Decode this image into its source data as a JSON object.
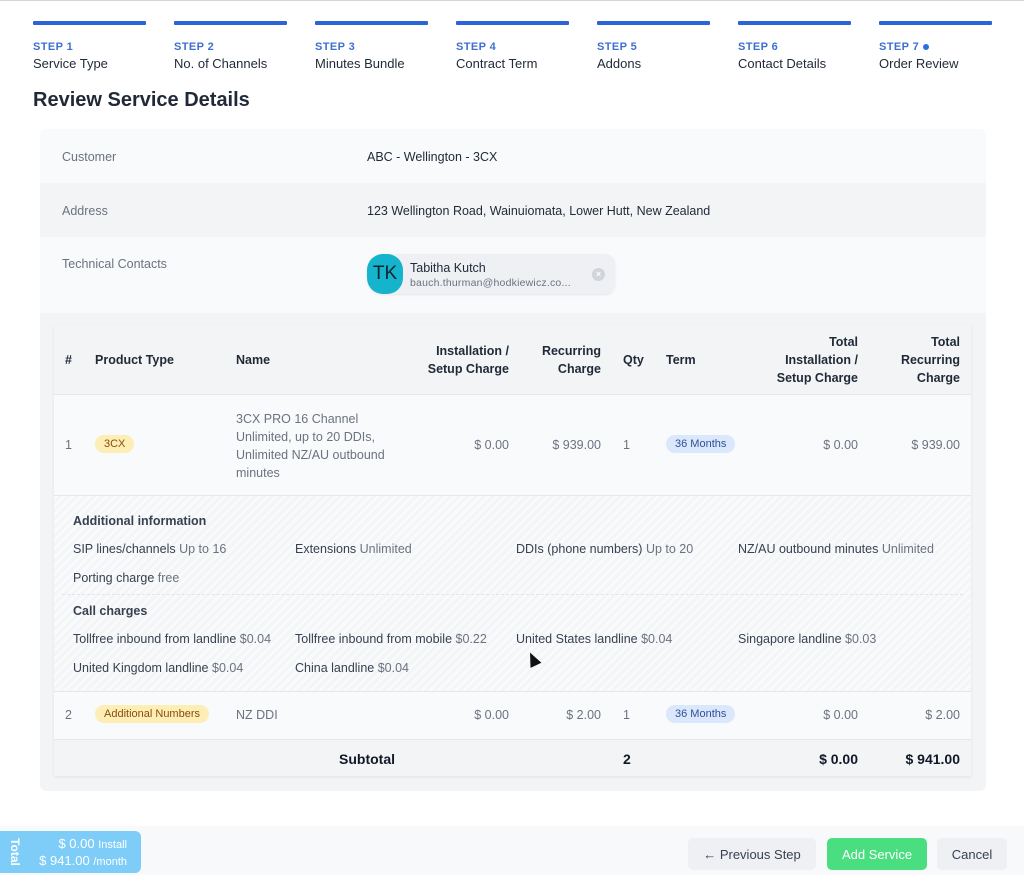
{
  "steps": [
    {
      "number": "STEP 1",
      "name": "Service Type",
      "current": false
    },
    {
      "number": "STEP 2",
      "name": "No. of Channels",
      "current": false
    },
    {
      "number": "STEP 3",
      "name": "Minutes Bundle",
      "current": false
    },
    {
      "number": "STEP 4",
      "name": "Contract Term",
      "current": false
    },
    {
      "number": "STEP 5",
      "name": "Addons",
      "current": false
    },
    {
      "number": "STEP 6",
      "name": "Contact Details",
      "current": false
    },
    {
      "number": "STEP 7",
      "name": "Order Review",
      "current": true
    }
  ],
  "page_title": "Review Service Details",
  "details": {
    "customer_label": "Customer",
    "customer_value": "ABC - Wellington - 3CX",
    "address_label": "Address",
    "address_value": "123 Wellington Road, Wainuiomata, Lower Hutt, New Zealand",
    "contacts_label": "Technical Contacts",
    "contact": {
      "initials": "TK",
      "name": "Tabitha Kutch",
      "email": "bauch.thurman@hodkiewicz.co...",
      "remove_icon": "×"
    }
  },
  "table": {
    "headers": {
      "num": "#",
      "product_type": "Product Type",
      "name": "Name",
      "install_1": "Installation /",
      "install_2": "Setup Charge",
      "recurring_1": "Recurring",
      "recurring_2": "Charge",
      "qty": "Qty",
      "term": "Term",
      "total_install_1": "Total",
      "total_install_2": "Installation /",
      "total_install_3": "Setup Charge",
      "total_recurring_1": "Total",
      "total_recurring_2": "Recurring",
      "total_recurring_3": "Charge"
    },
    "rows": [
      {
        "num": "1",
        "product_type": "3CX",
        "name": "3CX PRO 16 Channel Unlimited, up to 20 DDIs, Unlimited NZ/AU outbound minutes",
        "install": "$ 0.00",
        "recurring": "$ 939.00",
        "qty": "1",
        "term": "36 Months",
        "total_install": "$ 0.00",
        "total_recurring": "$ 939.00"
      },
      {
        "num": "2",
        "product_type": "Additional Numbers",
        "name": "NZ DDI",
        "install": "$ 0.00",
        "recurring": "$ 2.00",
        "qty": "1",
        "term": "36 Months",
        "total_install": "$ 0.00",
        "total_recurring": "$ 2.00"
      }
    ],
    "additional_info": {
      "heading": "Additional information",
      "items": [
        {
          "key": "SIP lines/channels",
          "value": "Up to 16"
        },
        {
          "key": "Extensions",
          "value": "Unlimited"
        },
        {
          "key": "DDIs (phone numbers)",
          "value": "Up to 20"
        },
        {
          "key": "NZ/AU outbound minutes",
          "value": "Unlimited"
        },
        {
          "key": "Porting charge",
          "value": "free"
        }
      ],
      "call_heading": "Call charges",
      "call_items": [
        {
          "key": "Tollfree inbound from landline",
          "value": "$0.04"
        },
        {
          "key": "Tollfree inbound from mobile",
          "value": "$0.22"
        },
        {
          "key": "United States landline",
          "value": "$0.04"
        },
        {
          "key": "Singapore landline",
          "value": "$0.03"
        },
        {
          "key": "United Kingdom landline",
          "value": "$0.04"
        },
        {
          "key": "China landline",
          "value": "$0.04"
        }
      ]
    },
    "subtotal": {
      "label": "Subtotal",
      "qty": "2",
      "total_install": "$ 0.00",
      "total_recurring": "$ 941.00"
    }
  },
  "footer": {
    "total_label": "Total",
    "install_amount": "$ 0.00",
    "install_suffix": "Install",
    "monthly_amount": "$ 941.00",
    "monthly_suffix": "/month",
    "prev_button": "← Previous Step",
    "add_button": "Add Service",
    "cancel_button": "Cancel"
  },
  "colors": {
    "accent": "#2b63d9",
    "success": "#4ade80",
    "total_box": "#7ecdf9",
    "avatar": "#15b3cc"
  }
}
